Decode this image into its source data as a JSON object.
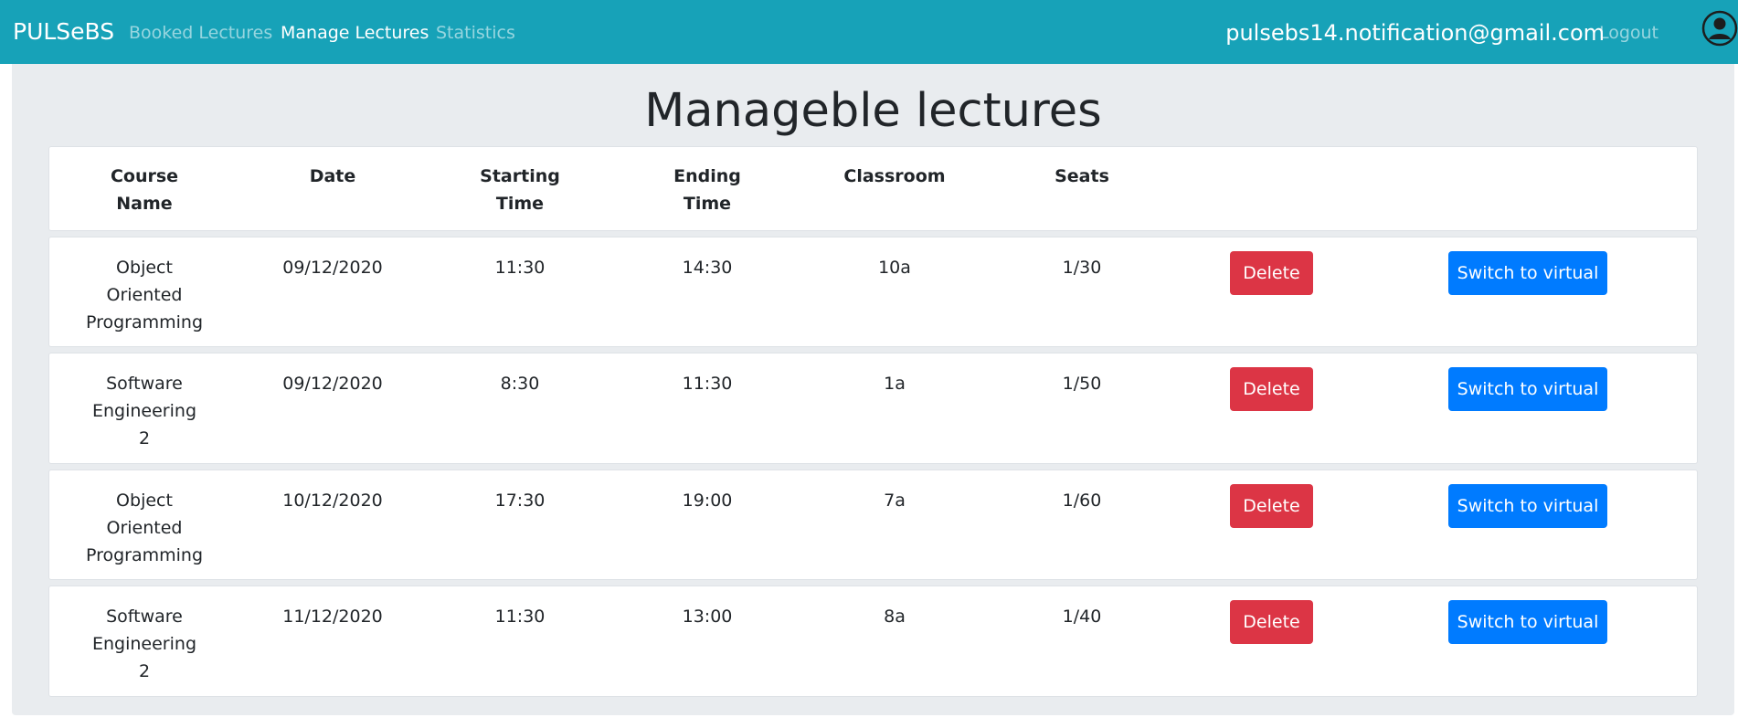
{
  "navbar": {
    "brand": "PULSeBS",
    "links": [
      {
        "label": "Booked Lectures",
        "active": false
      },
      {
        "label": "Manage Lectures",
        "active": true
      },
      {
        "label": "Statistics",
        "active": false
      }
    ],
    "user_email": "pulsebs14.notification@gmail.com",
    "logout_label": "Logout",
    "avatar_icon": "user-circle-icon"
  },
  "page": {
    "title": "Manageble lectures"
  },
  "table": {
    "headers": {
      "course": [
        "Course",
        "Name"
      ],
      "date": "Date",
      "start": [
        "Starting",
        "Time"
      ],
      "end": [
        "Ending",
        "Time"
      ],
      "classroom": "Classroom",
      "seats": "Seats"
    },
    "rows": [
      {
        "course": [
          "Object",
          "Oriented",
          "Programming"
        ],
        "date": "09/12/2020",
        "start": "11:30",
        "end": "14:30",
        "classroom": "10a",
        "seats": "1/30",
        "delete_label": "Delete",
        "virtual_label": "Switch to virtual"
      },
      {
        "course": [
          "Software",
          "Engineering",
          "2"
        ],
        "date": "09/12/2020",
        "start": "8:30",
        "end": "11:30",
        "classroom": "1a",
        "seats": "1/50",
        "delete_label": "Delete",
        "virtual_label": "Switch to virtual"
      },
      {
        "course": [
          "Object",
          "Oriented",
          "Programming"
        ],
        "date": "10/12/2020",
        "start": "17:30",
        "end": "19:00",
        "classroom": "7a",
        "seats": "1/60",
        "delete_label": "Delete",
        "virtual_label": "Switch to virtual"
      },
      {
        "course": [
          "Software",
          "Engineering",
          "2"
        ],
        "date": "11/12/2020",
        "start": "11:30",
        "end": "13:00",
        "classroom": "8a",
        "seats": "1/40",
        "delete_label": "Delete",
        "virtual_label": "Switch to virtual"
      }
    ]
  },
  "colors": {
    "navbar": "#17a2b8",
    "delete": "#dc3545",
    "virtual": "#007bff",
    "container": "#e9ecef"
  }
}
